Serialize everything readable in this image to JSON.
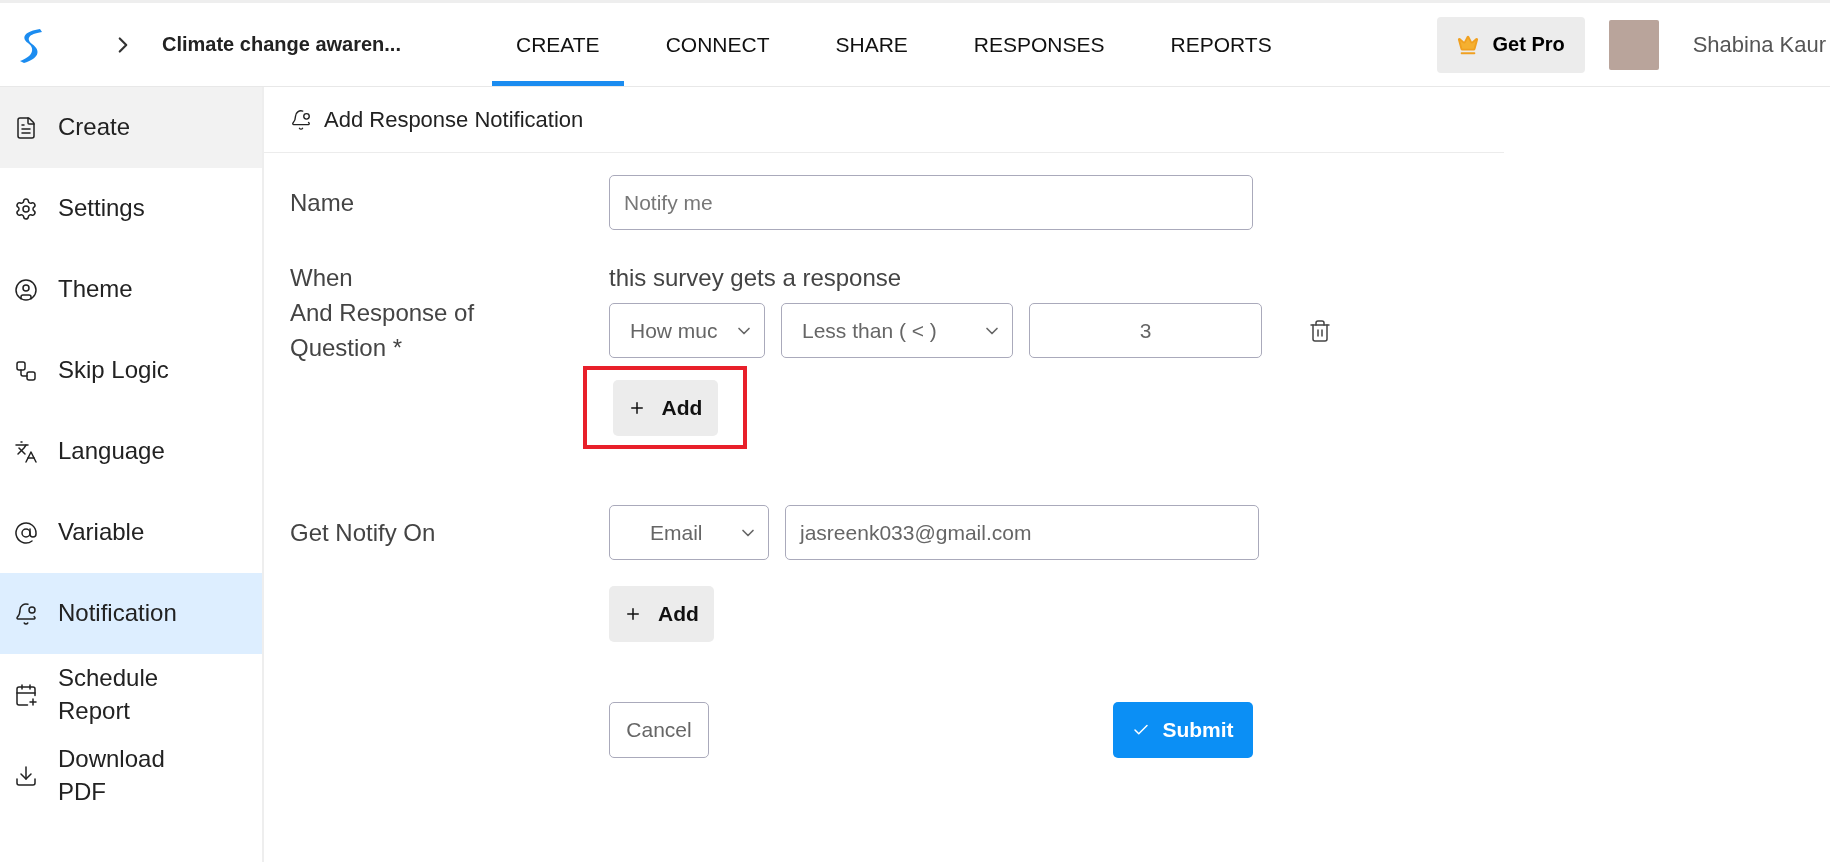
{
  "topbar": {
    "survey_title": "Climate change awaren...",
    "tabs": [
      {
        "label": "CREATE",
        "selected": true
      },
      {
        "label": "CONNECT",
        "selected": false
      },
      {
        "label": "SHARE",
        "selected": false
      },
      {
        "label": "RESPONSES",
        "selected": false
      },
      {
        "label": "REPORTS",
        "selected": false
      }
    ],
    "pro_button": "Get Pro",
    "user_name": "Shabina Kaur"
  },
  "sidebar": {
    "items": [
      {
        "label": "Create",
        "selected": false,
        "hover": true
      },
      {
        "label": "Settings",
        "selected": false,
        "hover": false
      },
      {
        "label": "Theme",
        "selected": false,
        "hover": false
      },
      {
        "label": "Skip Logic",
        "selected": false,
        "hover": false
      },
      {
        "label": "Language",
        "selected": false,
        "hover": false
      },
      {
        "label": "Variable",
        "selected": false,
        "hover": false
      },
      {
        "label": "Notification",
        "selected": true,
        "hover": false
      },
      {
        "label": "Schedule Report",
        "selected": false,
        "hover": false
      },
      {
        "label": "Download PDF",
        "selected": false,
        "hover": false
      }
    ]
  },
  "panel": {
    "title": "Add Response Notification",
    "name_label": "Name",
    "name_placeholder": "Notify me",
    "when_label": "When",
    "when_text": "this survey gets a response",
    "condition_label": "And Response of Question *",
    "condition": {
      "question": "How muc",
      "operator": "Less than ( < )",
      "value": "3"
    },
    "condition_add": {
      "label": "Add",
      "highlighted": true
    },
    "notify_label": "Get Notify On",
    "notify_channel": "Email",
    "notify_email": "jasreenk033@gmail.com",
    "notify_add": {
      "label": "Add",
      "highlighted": false
    },
    "cancel": "Cancel",
    "submit": "Submit"
  }
}
